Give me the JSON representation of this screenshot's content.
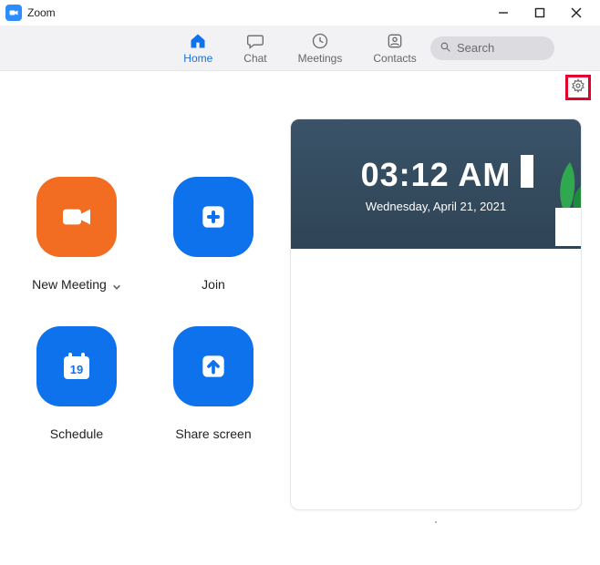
{
  "window": {
    "title": "Zoom"
  },
  "nav": {
    "items": [
      {
        "label": "Home"
      },
      {
        "label": "Chat"
      },
      {
        "label": "Meetings"
      },
      {
        "label": "Contacts"
      }
    ],
    "search_placeholder": "Search"
  },
  "actions": {
    "new_meeting": "New Meeting",
    "join": "Join",
    "schedule": "Schedule",
    "schedule_day": "19",
    "share_screen": "Share screen"
  },
  "clock": {
    "time": "03:12 AM",
    "date": "Wednesday, April 21, 2021"
  }
}
